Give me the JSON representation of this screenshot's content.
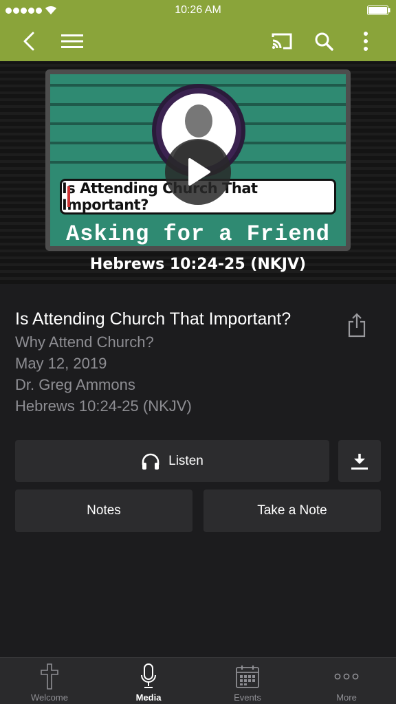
{
  "status_bar": {
    "time": "10:26 AM"
  },
  "nav": {
    "back_icon": "chevron-left-icon",
    "menu_icon": "hamburger-menu-icon",
    "cast_icon": "cast-icon",
    "search_icon": "search-icon",
    "more_icon": "vertical-dots-icon",
    "accent_color": "#8aa43a"
  },
  "hero": {
    "question": "Is Attending Church That Important?",
    "series_banner": "Asking for a Friend",
    "scripture": "Hebrews 10:24-25 (NKJV)",
    "play_icon": "play-icon"
  },
  "sermon": {
    "title": "Is Attending Church That Important?",
    "series": "Why Attend Church?",
    "date": "May 12, 2019",
    "speaker": "Dr. Greg Ammons",
    "passage": "Hebrews 10:24-25 (NKJV)"
  },
  "actions": {
    "listen_label": "Listen",
    "notes_label": "Notes",
    "take_note_label": "Take a Note"
  },
  "tabs": [
    {
      "label": "Welcome",
      "icon": "cross-icon"
    },
    {
      "label": "Media",
      "icon": "microphone-icon",
      "active": true
    },
    {
      "label": "Events",
      "icon": "calendar-icon"
    },
    {
      "label": "More",
      "icon": "more-dots-icon"
    }
  ]
}
